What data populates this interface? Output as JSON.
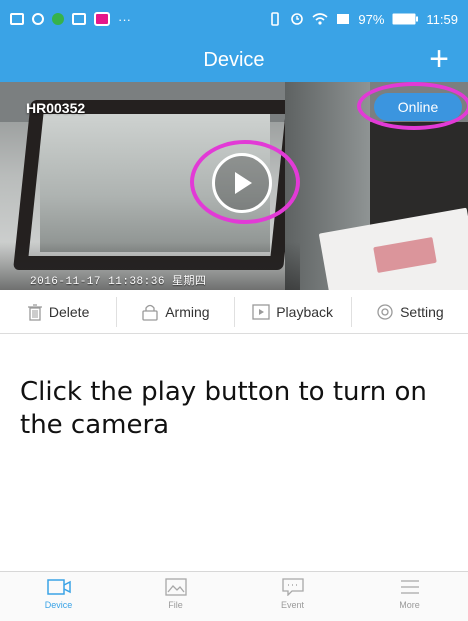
{
  "status_bar": {
    "battery_percent": "97%",
    "time": "11:59",
    "left_icons": [
      "gallery-icon",
      "circle-icon",
      "color-dot-icon",
      "image-icon",
      "message-icon",
      "more-icon"
    ],
    "right_icons": [
      "vibrate-icon",
      "alarm-icon",
      "wifi-icon",
      "data-icon",
      "battery-icon"
    ]
  },
  "header": {
    "title": "Device",
    "add_label": "+",
    "background": "#3aa3e6"
  },
  "preview": {
    "camera_name": "HR00352",
    "status_label": "Online",
    "timestamp": "2016-11-17 11:38:36 星期四",
    "highlight_color": "#e23ad6"
  },
  "actions": [
    {
      "label": "Delete",
      "icon": "trash-icon"
    },
    {
      "label": "Arming",
      "icon": "lock-icon"
    },
    {
      "label": "Playback",
      "icon": "playback-icon"
    },
    {
      "label": "Setting",
      "icon": "gear-icon"
    }
  ],
  "instruction": "Click the play button to turn on the camera",
  "tabs": [
    {
      "label": "Device",
      "icon": "camera-icon",
      "active": true
    },
    {
      "label": "File",
      "icon": "image-icon",
      "active": false
    },
    {
      "label": "Event",
      "icon": "chat-icon",
      "active": false
    },
    {
      "label": "More",
      "icon": "menu-icon",
      "active": false
    }
  ]
}
